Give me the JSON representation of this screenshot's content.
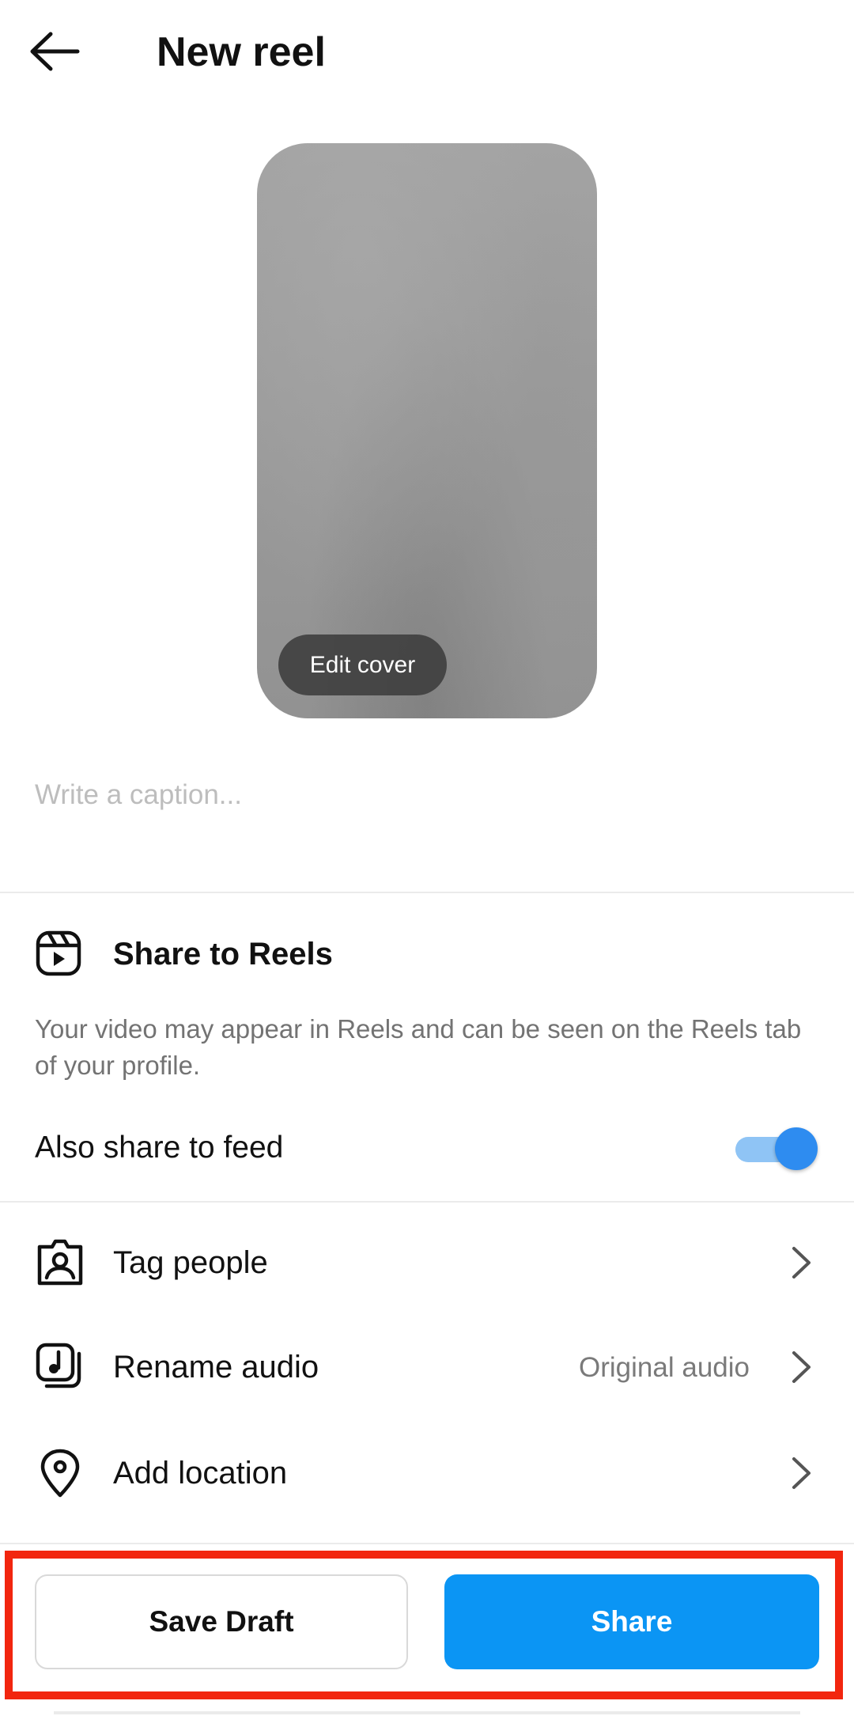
{
  "header": {
    "title": "New reel",
    "back_icon": "arrow-left-icon"
  },
  "cover": {
    "edit_label": "Edit cover"
  },
  "caption": {
    "placeholder": "Write a caption...",
    "value": ""
  },
  "reels": {
    "icon": "reels-icon",
    "title": "Share to Reels",
    "description": "Your video may appear in Reels and can be seen on the Reels tab of your profile.",
    "also_share_label": "Also share to feed",
    "also_share_enabled": true
  },
  "options": [
    {
      "label": "Tag people",
      "icon": "tag-person-icon",
      "value": ""
    },
    {
      "label": "Rename audio",
      "icon": "audio-icon",
      "value": "Original audio"
    },
    {
      "label": "Add location",
      "icon": "location-pin-icon",
      "value": ""
    }
  ],
  "actions": {
    "save_draft_label": "Save Draft",
    "share_label": "Share"
  },
  "colors": {
    "accent": "#0b95f4",
    "toggle_track": "#8fc4f5",
    "toggle_knob": "#2e8cf0",
    "highlight": "#f2260f",
    "secondary_text": "#737373",
    "placeholder": "#bdbdbd"
  }
}
